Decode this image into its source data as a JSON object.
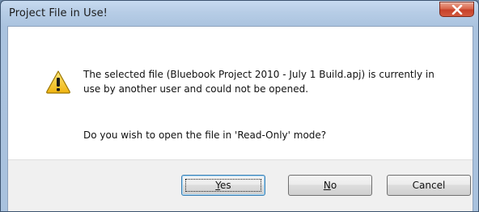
{
  "window": {
    "title": "Project File in Use!",
    "close_label": "X"
  },
  "message": {
    "line1": "The selected file (Bluebook Project 2010 - July 1 Build.apj) is currently in",
    "line2": "use by another user and could not be opened.",
    "question": "Do you wish to open the file in 'Read-Only' mode?"
  },
  "buttons": {
    "yes": {
      "mnemonic": "Y",
      "rest": "es"
    },
    "no": {
      "mnemonic": "N",
      "rest": "o"
    },
    "cancel": {
      "label": "Cancel"
    }
  },
  "icons": {
    "warning": "warning-icon",
    "close": "close-icon"
  },
  "colors": {
    "close_button": "#c7412a",
    "warning_yellow": "#f3c623",
    "default_button_border": "#3c7fb1"
  }
}
